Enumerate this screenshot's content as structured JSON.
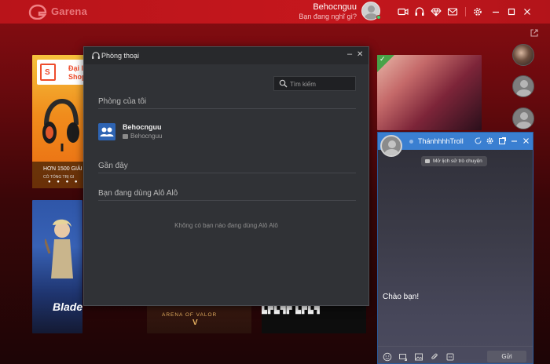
{
  "app": {
    "title": "Garena"
  },
  "user": {
    "name": "Behocnguu",
    "status": "Bạn đang nghĩ gì?"
  },
  "titlebar_icons": [
    "video-icon",
    "headset-icon",
    "diamond-icon",
    "mail-icon",
    "gear-icon",
    "minimize-icon",
    "maximize-icon",
    "close-icon"
  ],
  "shop_tile": {
    "card_text_1": "Đại lý",
    "card_text_2": "Shope",
    "promo": "HƠN 1500 GIẢI",
    "promo_sub": "CÓ TỔNG TRỊ GI"
  },
  "game_tiles": {
    "blade": "Blade",
    "aov": "ARENA OF VALOR",
    "aov_mark": "V",
    "dark": "▙▛▙▜▛ ▙▛▙▜"
  },
  "voice_window": {
    "title": "Phòng thoại",
    "search_placeholder": "Tìm kiếm",
    "my_rooms_title": "Phòng của tôi",
    "room": {
      "name": "Behocnguu",
      "owner": "Behocnguu"
    },
    "recent_title": "Gần đây",
    "using_title": "Bạn đang dùng Alô Alô",
    "empty_text": "Không có bạn nào đang dùng Alô Alô"
  },
  "chat_window": {
    "contact": "ThánhhhhTroll",
    "history_label": "Mở lịch sử trò chuyện",
    "message": "Chào bạn!",
    "send_label": "Gửi"
  },
  "colors": {
    "brand": "#c5171d",
    "chat_header": "#3a7fd1",
    "online": "#3bd16f"
  }
}
